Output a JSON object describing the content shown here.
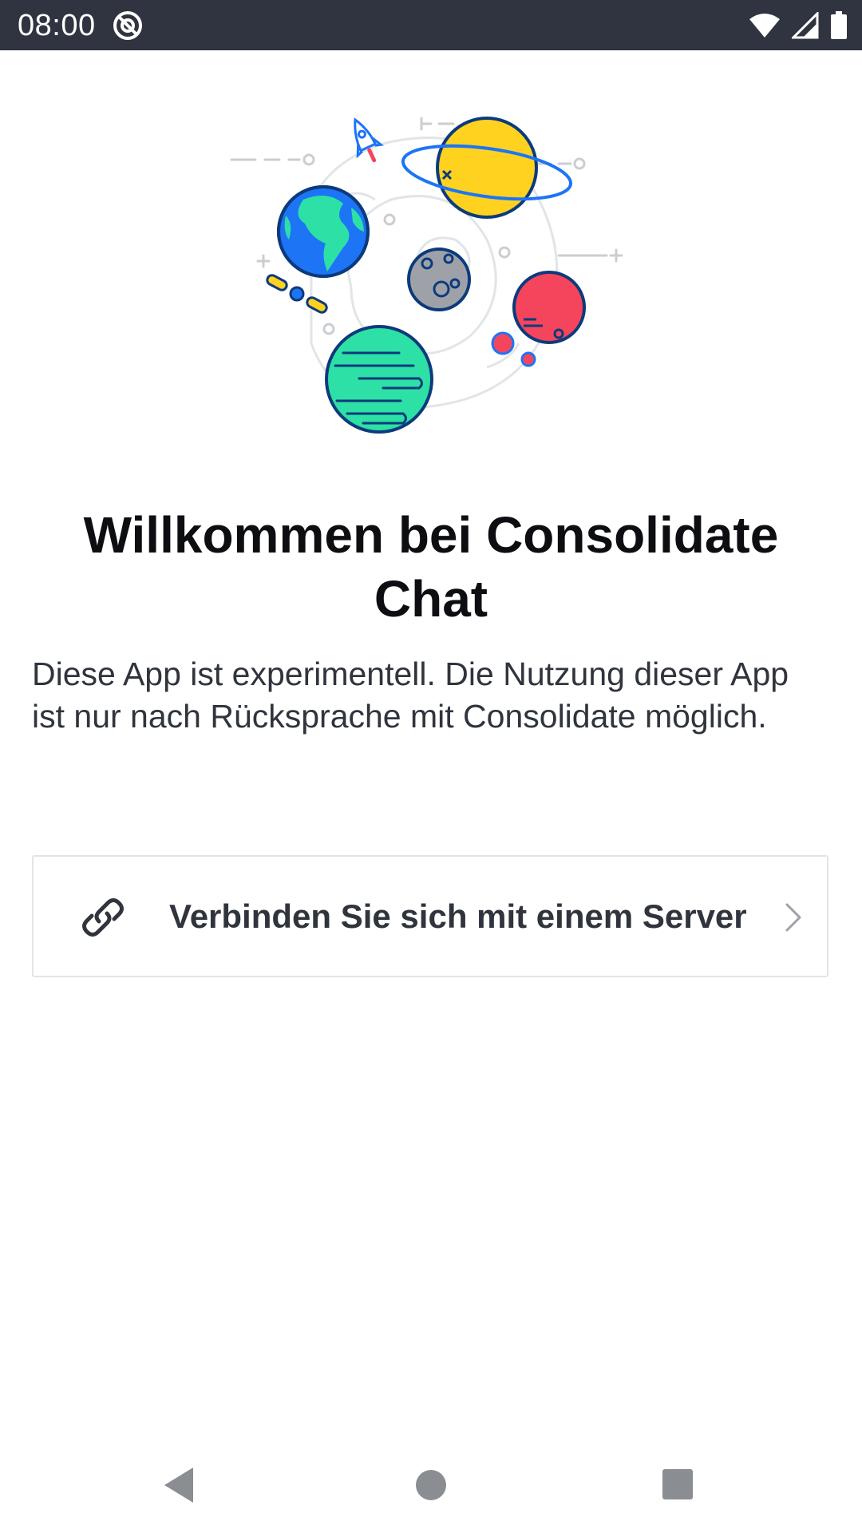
{
  "status_bar": {
    "time": "08:00",
    "app_icon": "at-sign-icon",
    "icons": [
      "wifi-icon",
      "cell-signal-icon",
      "battery-icon"
    ],
    "background_color": "#2f3440"
  },
  "illustration": {
    "icon": "space-planets-illustration",
    "colors": {
      "earth_blue": "#1d74f5",
      "earth_green": "#2de0a5",
      "saturn_yellow": "#ffd21f",
      "moon_gray": "#9ea2a8",
      "red_planet": "#f5455c",
      "green_planet": "#2de0a5",
      "outline": "#0c3a7c"
    }
  },
  "welcome": {
    "title": "Willkommen bei Consolidate Chat",
    "description": "Diese App ist experimentell. Die Nutzung dieser App ist nur nach Rücksprache mit Consolidate möglich."
  },
  "connect": {
    "label": "Verbinden Sie sich mit einem Server",
    "icon": "link-icon",
    "chevron": "chevron-right-icon"
  },
  "navigation": {
    "back": "back-triangle-icon",
    "home": "home-circle-icon",
    "recents": "recents-square-icon"
  }
}
